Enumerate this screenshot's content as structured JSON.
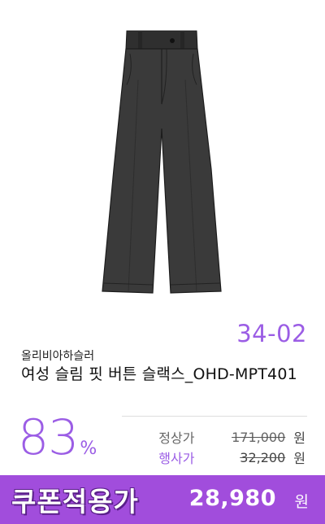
{
  "product": {
    "image_alt": "여성 슬림 핏 버튼 슬랙스 이미지",
    "code": "34-02",
    "brand": "올리비아하슬러",
    "name": "여성 슬림 핏 버튼 슬랙스_OHD-MPT401"
  },
  "discount": {
    "value": "83",
    "unit": "%"
  },
  "prices": {
    "regular_label": "정상가",
    "regular_value": "171,000",
    "event_label": "행사가",
    "event_value": "32,200",
    "currency": "원"
  },
  "coupon": {
    "label": "쿠폰적용가",
    "price": "28,980",
    "currency": "원"
  },
  "colors": {
    "accent": "#9b5de5",
    "coupon_bg": "#a14ddc",
    "coupon_outline": "#5a1f8a"
  },
  "icons": {
    "product_image": "trousers-image"
  }
}
